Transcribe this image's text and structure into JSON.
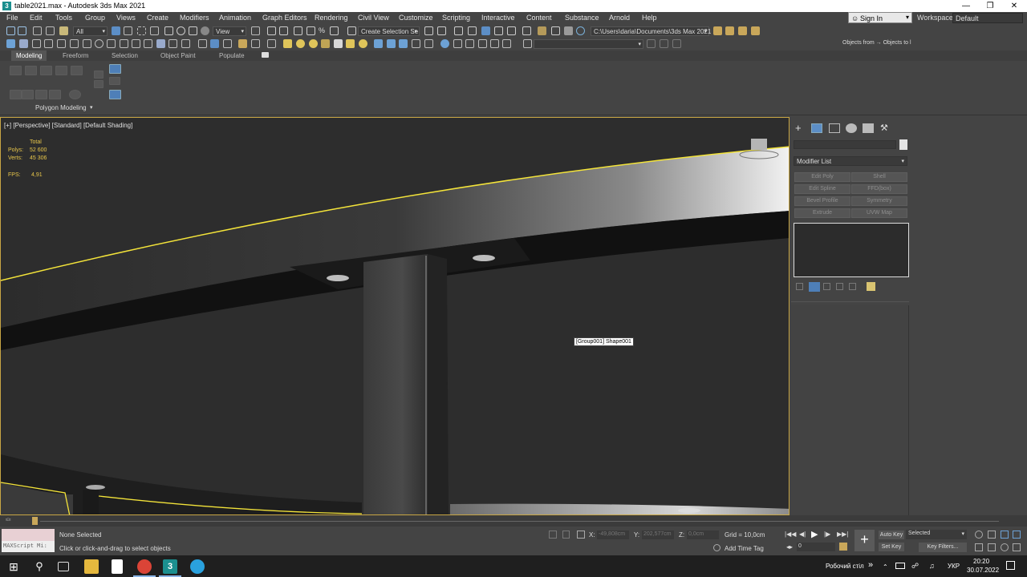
{
  "window": {
    "title": "table2021.max - Autodesk 3ds Max 2021",
    "app_icon": "3"
  },
  "menu": [
    "File",
    "Edit",
    "Tools",
    "Group",
    "Views",
    "Create",
    "Modifiers",
    "Animation",
    "Graph Editors",
    "Rendering",
    "Civil View",
    "Customize",
    "Scripting",
    "Interactive",
    "Content",
    "Substance",
    "Arnold",
    "Help"
  ],
  "account": {
    "sign_in": "Sign In",
    "workspaces_label": "Workspaces:",
    "workspace_value": "Default"
  },
  "toolbar": {
    "filter_value": "All",
    "ref_coord_value": "View",
    "selection_set_value": "Create Selection Se",
    "project_path": "C:\\Users\\daria\\Documents\\3ds Max 2021",
    "scene_explorer_text": "Objects from → Objects to l"
  },
  "ribbon": {
    "tabs": [
      "Modeling",
      "Freeform",
      "Selection",
      "Object Paint",
      "Populate"
    ],
    "active_tab": "Modeling",
    "panel_label": "Polygon Modeling"
  },
  "viewport": {
    "label": "[+] [Perspective] [Standard] [Default Shading]",
    "stats_header": "Total",
    "polys_label": "Polys:",
    "polys_value": "52 600",
    "verts_label": "Verts:",
    "verts_value": "45 306",
    "fps_label": "FPS:",
    "fps_value": "4,91",
    "tooltip": "[Group001] Shape001"
  },
  "command_panel": {
    "modifier_list_label": "Modifier List",
    "modifier_buttons": [
      "Edit Poly",
      "Shell",
      "Edit Spline",
      "FFD(box)",
      "Bevel Profile",
      "Symmetry",
      "Extrude",
      "UVW Map"
    ]
  },
  "timeline": {
    "frame_label": "0 / 100"
  },
  "status": {
    "maxscript_placeholder": "MAXScript Mi:",
    "selection_status": "None Selected",
    "prompt": "Click or click-and-drag to select objects",
    "x_label": "X:",
    "x_value": "-49,808cm",
    "y_label": "Y:",
    "y_value": "202,577cm",
    "z_label": "Z:",
    "z_value": "0,0cm",
    "grid": "Grid = 10,0cm",
    "add_time_tag": "Add Time Tag",
    "auto_key": "Auto Key",
    "set_key": "Set Key",
    "key_mode_value": "Selected",
    "key_filters": "Key Filters...",
    "frame_value": "0"
  },
  "taskbar": {
    "desktop_label": "Робочий стіл",
    "language": "УКР",
    "time": "20:20",
    "date": "30.07.2022",
    "chevron": "»"
  },
  "colors": {
    "accent_yellow": "#e8c64a",
    "viewport_border": "#c8a644",
    "ui_bg": "#444444"
  }
}
